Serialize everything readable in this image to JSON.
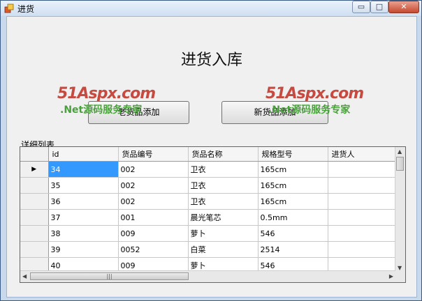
{
  "window": {
    "title": "进货",
    "controls": {
      "minimize": "▭",
      "maximize": "□",
      "close": "✕"
    }
  },
  "form": {
    "heading": "进货入库",
    "old_button": "老货品添加",
    "new_button": "新货品添加",
    "group_label": "详细列表"
  },
  "watermark": {
    "logo": "51Aspx",
    "domain": ".com",
    "tagline": ".Net源码服务专家"
  },
  "grid": {
    "columns": [
      "id",
      "货品编号",
      "货品名称",
      "规格型号",
      "进货人"
    ],
    "current_row_marker": "▶",
    "rows": [
      [
        "34",
        "002",
        "卫衣",
        "165cm",
        ""
      ],
      [
        "35",
        "002",
        "卫衣",
        "165cm",
        ""
      ],
      [
        "36",
        "002",
        "卫衣",
        "165cm",
        ""
      ],
      [
        "37",
        "001",
        "晨光笔芯",
        "0.5mm",
        ""
      ],
      [
        "38",
        "009",
        "萝卜",
        "546",
        ""
      ],
      [
        "39",
        "0052",
        "白菜",
        "2514",
        ""
      ],
      [
        "40",
        "009",
        "萝卜",
        "546",
        ""
      ]
    ],
    "scroll": {
      "h_grip": "|||"
    }
  }
}
